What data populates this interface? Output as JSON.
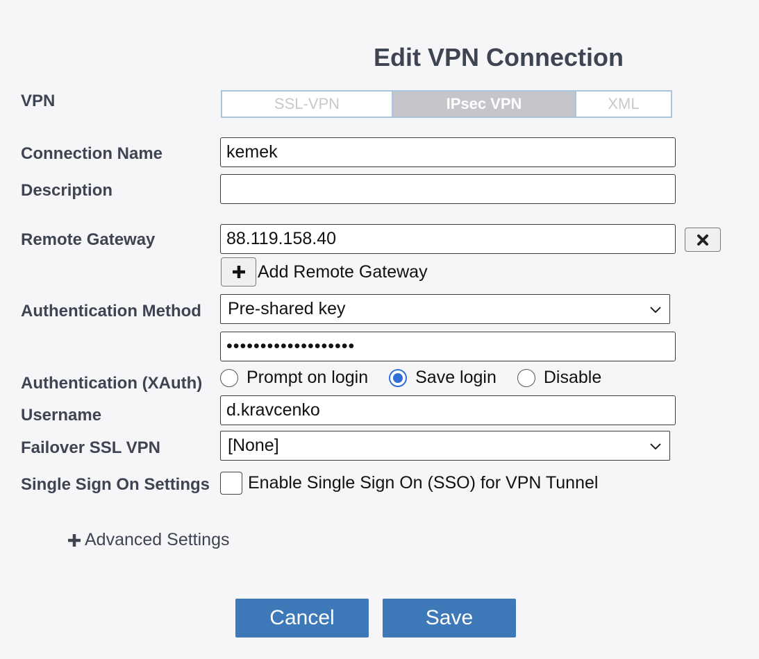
{
  "dialog": {
    "title": "Edit VPN Connection"
  },
  "labels": {
    "vpn": "VPN",
    "connection_name": "Connection Name",
    "description": "Description",
    "remote_gateway": "Remote Gateway",
    "auth_method": "Authentication Method",
    "auth_xauth": "Authentication (XAuth)",
    "username": "Username",
    "failover": "Failover SSL VPN",
    "sso": "Single Sign On Settings"
  },
  "vpn_type": {
    "options": [
      "SSL-VPN",
      "IPsec VPN",
      "XML"
    ],
    "selected": "IPsec VPN"
  },
  "fields": {
    "connection_name": "kemek",
    "description": "",
    "remote_gateway": "88.119.158.40",
    "pre_shared_key": "•••••••••••••••••••",
    "username": "d.kravcenko"
  },
  "add_gateway": {
    "label": "Add Remote Gateway"
  },
  "auth_method": {
    "selected": "Pre-shared key"
  },
  "xauth": {
    "options": [
      "Prompt on login",
      "Save login",
      "Disable"
    ],
    "selected": "Save login"
  },
  "failover": {
    "selected": "[None]"
  },
  "sso": {
    "label": "Enable Single Sign On (SSO) for VPN Tunnel",
    "checked": false
  },
  "advanced": {
    "label": "Advanced Settings"
  },
  "buttons": {
    "cancel": "Cancel",
    "save": "Save"
  },
  "colors": {
    "primary_button": "#3d78b8",
    "radio_accent": "#2f6fd6",
    "segment_active": "#c4c6ca"
  }
}
